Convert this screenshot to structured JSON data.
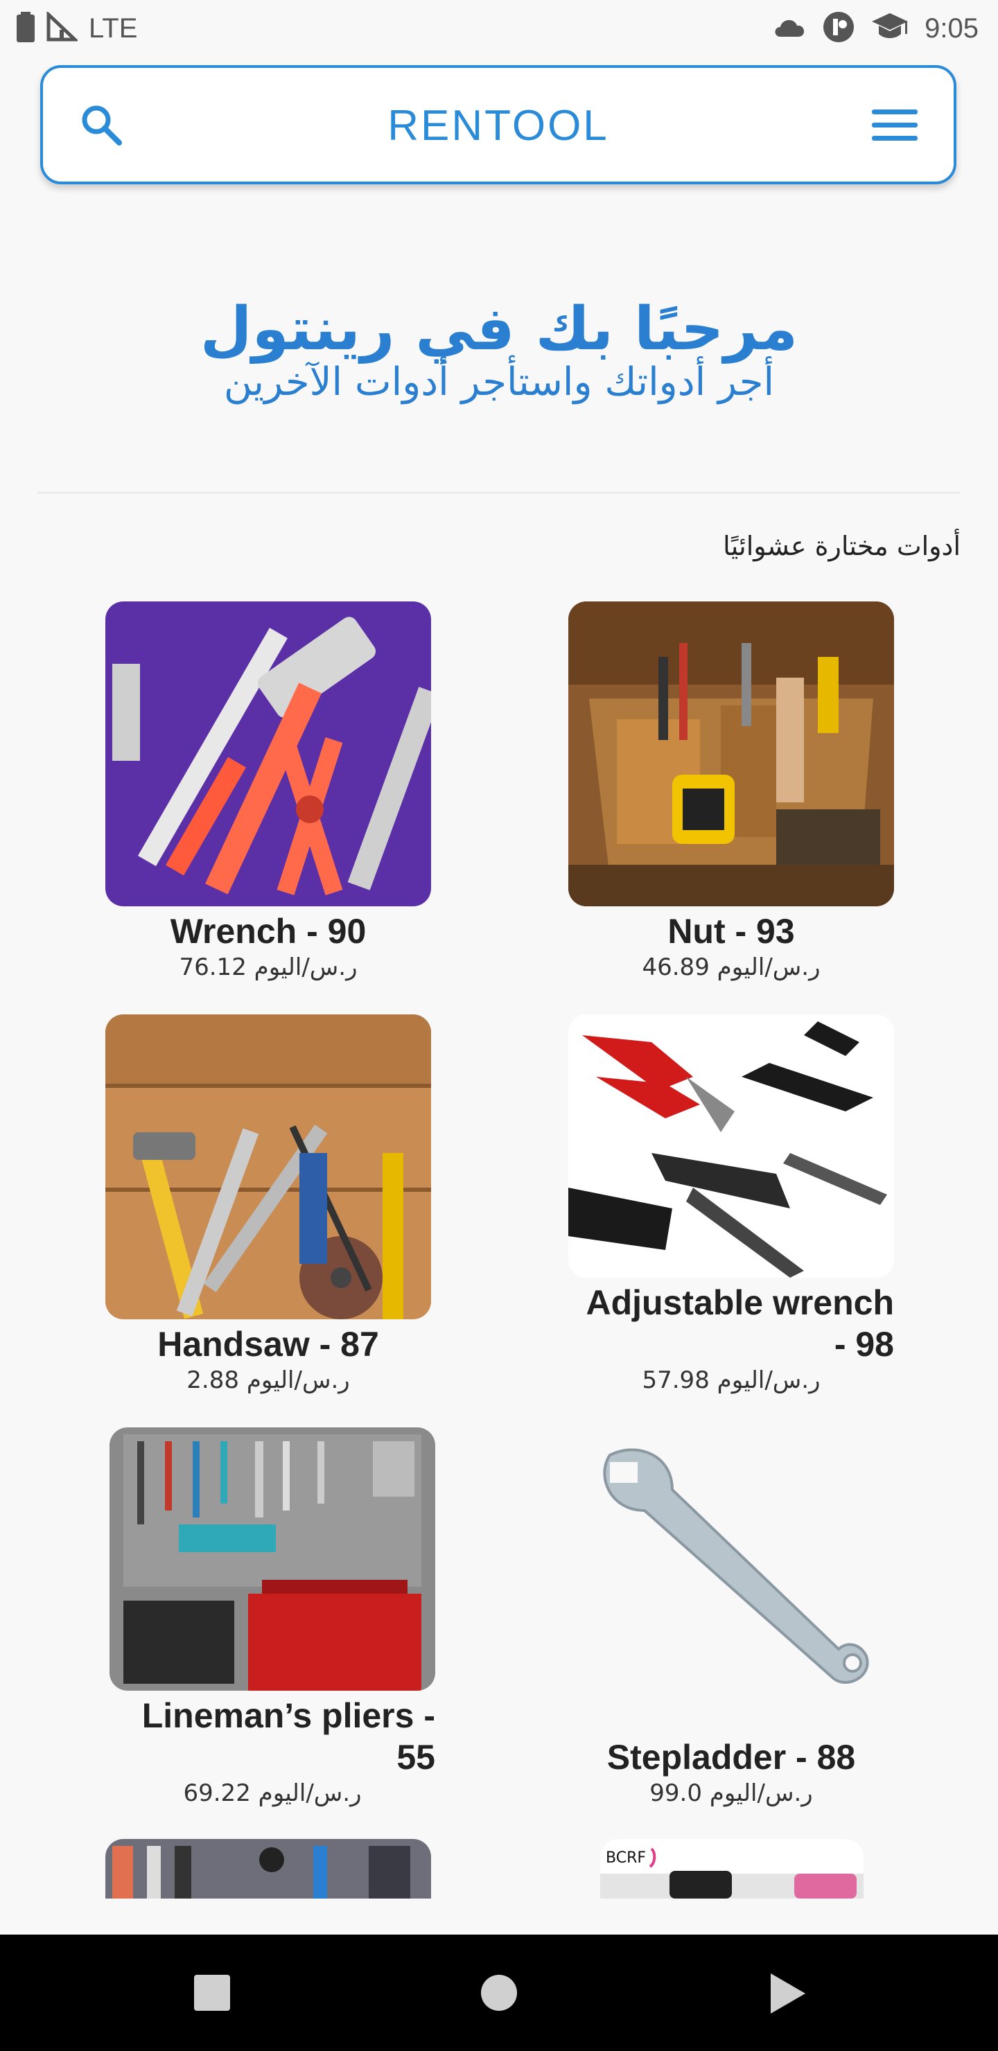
{
  "status_bar": {
    "network": "LTE",
    "time": "9:05",
    "icons": [
      "battery-icon",
      "signal-icon",
      "cloud-icon",
      "app-icon",
      "graduation-cap-icon"
    ]
  },
  "header": {
    "title": "RENTOOL",
    "icons": [
      "search-icon",
      "menu-icon"
    ],
    "accent_color": "#2a8bd9"
  },
  "welcome": {
    "title": "مرحبًا بك في رينتول",
    "subtitle": "أجر أدواتك واستأجر أدوات الآخرين"
  },
  "section": {
    "title": "أدوات مختارة عشوائيًا"
  },
  "tools": [
    {
      "name": "Nut - 93",
      "price": "46.89 ر.س/اليوم"
    },
    {
      "name": "Wrench - 90",
      "price": "76.12 ر.س/اليوم"
    },
    {
      "name": "Adjustable wrench - 98",
      "price": "57.98 ر.س/اليوم"
    },
    {
      "name": "Handsaw - 87",
      "price": "2.88 ر.س/اليوم"
    },
    {
      "name": "Stepladder - 88",
      "price": "99.0 ر.س/اليوم"
    },
    {
      "name": "Lineman’s pliers - 55",
      "price": "69.22 ر.س/اليوم"
    }
  ],
  "nav": {
    "icons": [
      "recents-icon",
      "home-icon",
      "back-icon"
    ]
  }
}
